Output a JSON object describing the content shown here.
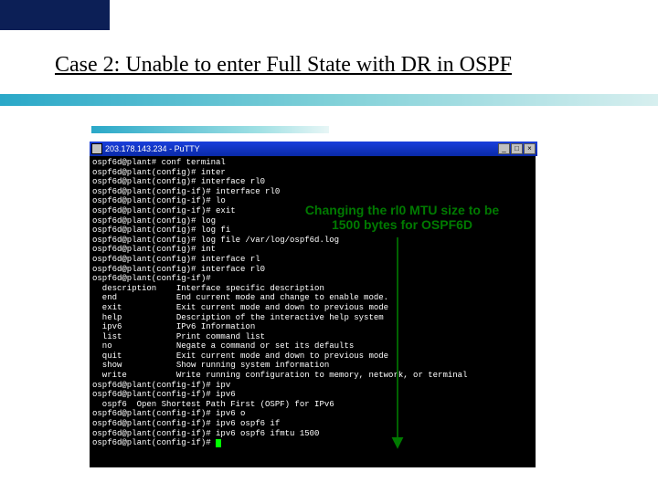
{
  "slide": {
    "title": "Case 2: Unable to enter Full State with DR in OSPF"
  },
  "window": {
    "title": "203.178.143.234 - PuTTY",
    "btn_min": "_",
    "btn_max": "□",
    "btn_close": "×"
  },
  "annotation": {
    "text": "Changing the rl0 MTU size to be 1500 bytes for OSPF6D"
  },
  "terminal": {
    "text": "ospf6d@plant# conf terminal\nospf6d@plant(config)# inter\nospf6d@plant(config)# interface rl0\nospf6d@plant(config-if)# interface rl0\nospf6d@plant(config-if)# lo\nospf6d@plant(config-if)# exit\nospf6d@plant(config)# log\nospf6d@plant(config)# log fi\nospf6d@plant(config)# log file /var/log/ospf6d.log\nospf6d@plant(config)# int\nospf6d@plant(config)# interface rl\nospf6d@plant(config)# interface rl0\nospf6d@plant(config-if)#\n  description    Interface specific description\n  end            End current mode and change to enable mode.\n  exit           Exit current mode and down to previous mode\n  help           Description of the interactive help system\n  ipv6           IPv6 Information\n  list           Print command list\n  no             Negate a command or set its defaults\n  quit           Exit current mode and down to previous mode\n  show           Show running system information\n  write          Write running configuration to memory, network, or terminal\nospf6d@plant(config-if)# ipv\nospf6d@plant(config-if)# ipv6\n  ospf6  Open Shortest Path First (OSPF) for IPv6\nospf6d@plant(config-if)# ipv6 o\nospf6d@plant(config-if)# ipv6 ospf6 if\nospf6d@plant(config-if)# ipv6 ospf6 ifmtu 1500\nospf6d@plant(config-if)# "
  }
}
